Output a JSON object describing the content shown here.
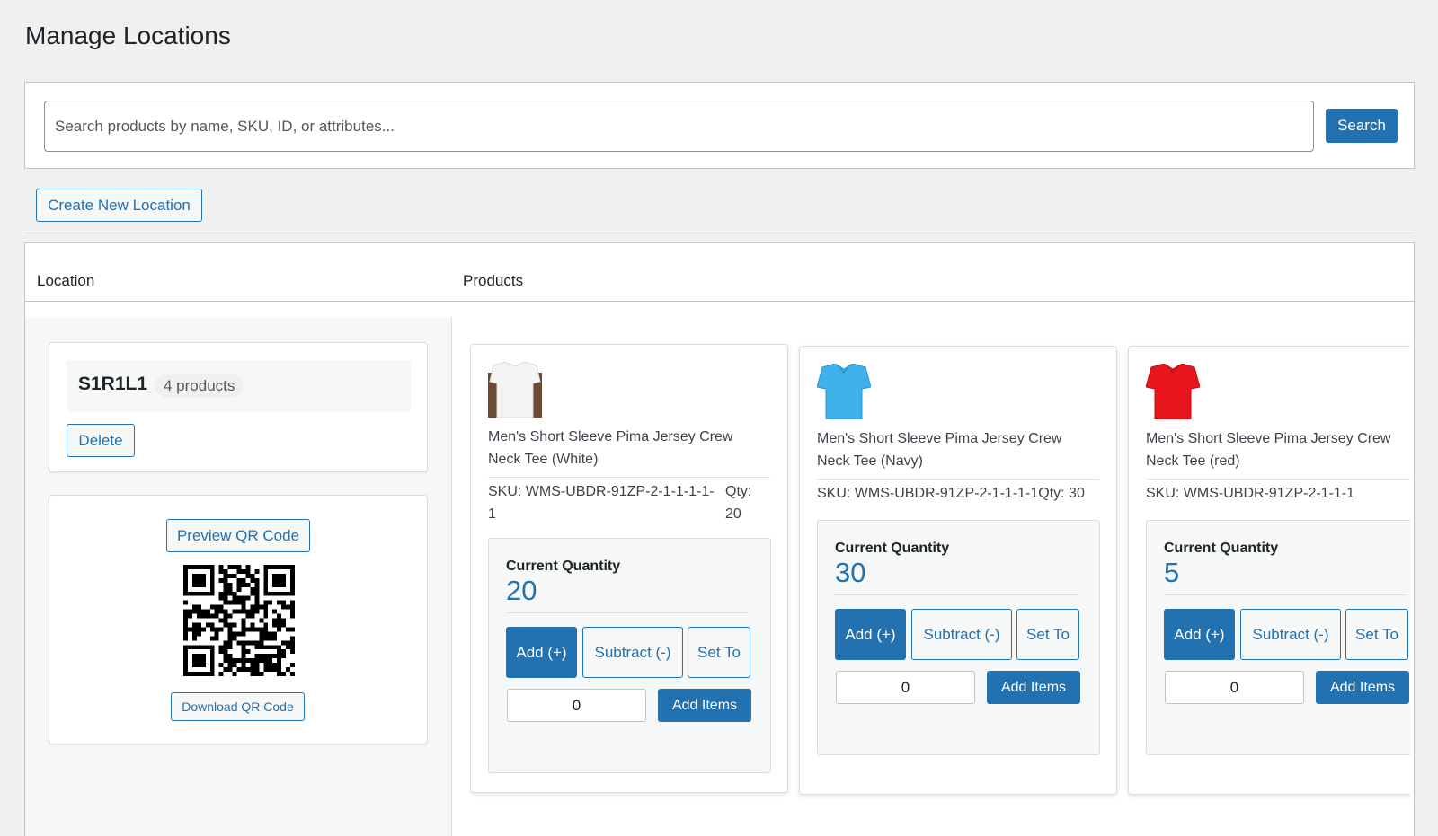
{
  "page": {
    "title": "Manage Locations"
  },
  "search": {
    "placeholder": "Search products by name, SKU, ID, or attributes...",
    "button": "Search"
  },
  "create_button": "Create New Location",
  "table": {
    "col_location": "Location",
    "col_products": "Products"
  },
  "location": {
    "name": "S1R1L1",
    "count": "4 products",
    "delete": "Delete",
    "preview_qr": "Preview QR Code",
    "download_qr": "Download QR Code"
  },
  "quantity_label": "Current Quantity",
  "mode_labels": {
    "add": "Add (+)",
    "subtract": "Subtract (-)",
    "set": "Set To"
  },
  "add_items_label": "Add Items",
  "products": [
    {
      "name": "Men's Short Sleeve Pima Jersey Crew Neck Tee (White)",
      "sku": "SKU: WMS-UBDR-91ZP-2-1-1-1-1-1",
      "qty_text": "Qty: 20",
      "current_qty": "20",
      "input_value": "0",
      "shirt_color": "#f4f4f4"
    },
    {
      "name": "Men's Short Sleeve Pima Jersey Crew Neck Tee (Navy)",
      "sku": "SKU: WMS-UBDR-91ZP-2-1-1-1-1",
      "qty_text": "Qty: 30",
      "current_qty": "30",
      "input_value": "0",
      "shirt_color": "#3eb1ea"
    },
    {
      "name": "Men's Short Sleeve Pima Jersey Crew Neck Tee (red)",
      "sku": "SKU: WMS-UBDR-91ZP-2-1-1-1",
      "qty_text": "",
      "current_qty": "5",
      "input_value": "0",
      "shirt_color": "#e8161c"
    }
  ]
}
